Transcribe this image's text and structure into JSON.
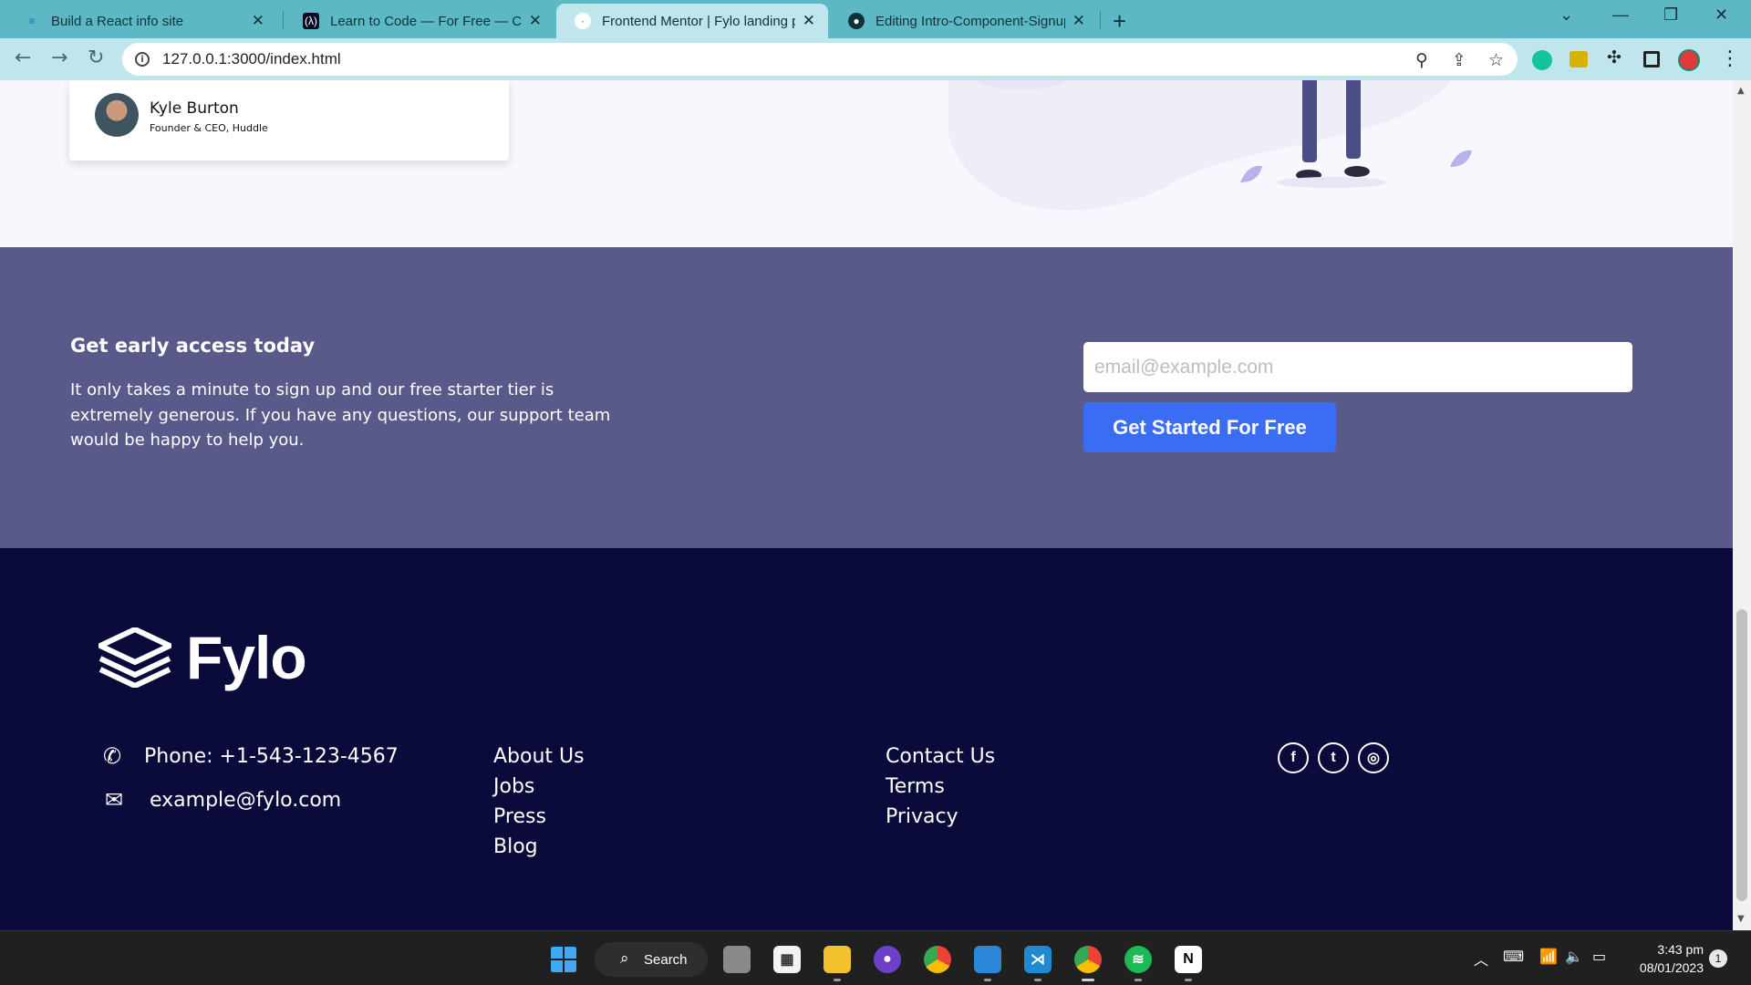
{
  "browser": {
    "tabs": [
      {
        "title": "Build a React info site",
        "icon": "react-favicon"
      },
      {
        "title": "Learn to Code — For Free — Coc",
        "icon": "freecodecamp-favicon"
      },
      {
        "title": "Frontend Mentor | Fylo landing p",
        "icon": "frontend-mentor-favicon"
      },
      {
        "title": "Editing Intro-Component-Signup",
        "icon": "github-favicon"
      }
    ],
    "new_tab": "+",
    "url": "127.0.0.1:3000/index.html"
  },
  "testimonial": {
    "name": "Kyle Burton",
    "role": "Founder & CEO, Huddle"
  },
  "cta": {
    "heading": "Get early access today",
    "text": "It only takes a minute to sign up and our free starter tier is extremely generous. If you have any questions, our support team would be happy to help you.",
    "email_placeholder": "email@example.com",
    "button_label": "Get Started For Free"
  },
  "footer": {
    "brand": "Fylo",
    "phone": "Phone: +1-543-123-4567",
    "email": "example@fylo.com",
    "links_col1": [
      "About Us",
      "Jobs",
      "Press",
      "Blog"
    ],
    "links_col2": [
      "Contact Us",
      "Terms",
      "Privacy"
    ],
    "social": [
      {
        "name": "facebook-icon",
        "glyph": "f"
      },
      {
        "name": "twitter-icon",
        "glyph": "t"
      },
      {
        "name": "instagram-icon",
        "glyph": "◎"
      }
    ]
  },
  "taskbar": {
    "search_label": "Search",
    "time": "3:43 pm",
    "date": "08/01/2023",
    "notifications": "1"
  },
  "colors": {
    "cta_bg": "#595a8a",
    "footer_bg": "#0b0b3b",
    "button": "#3a6cf4",
    "tabbar": "#5bb8c4"
  }
}
